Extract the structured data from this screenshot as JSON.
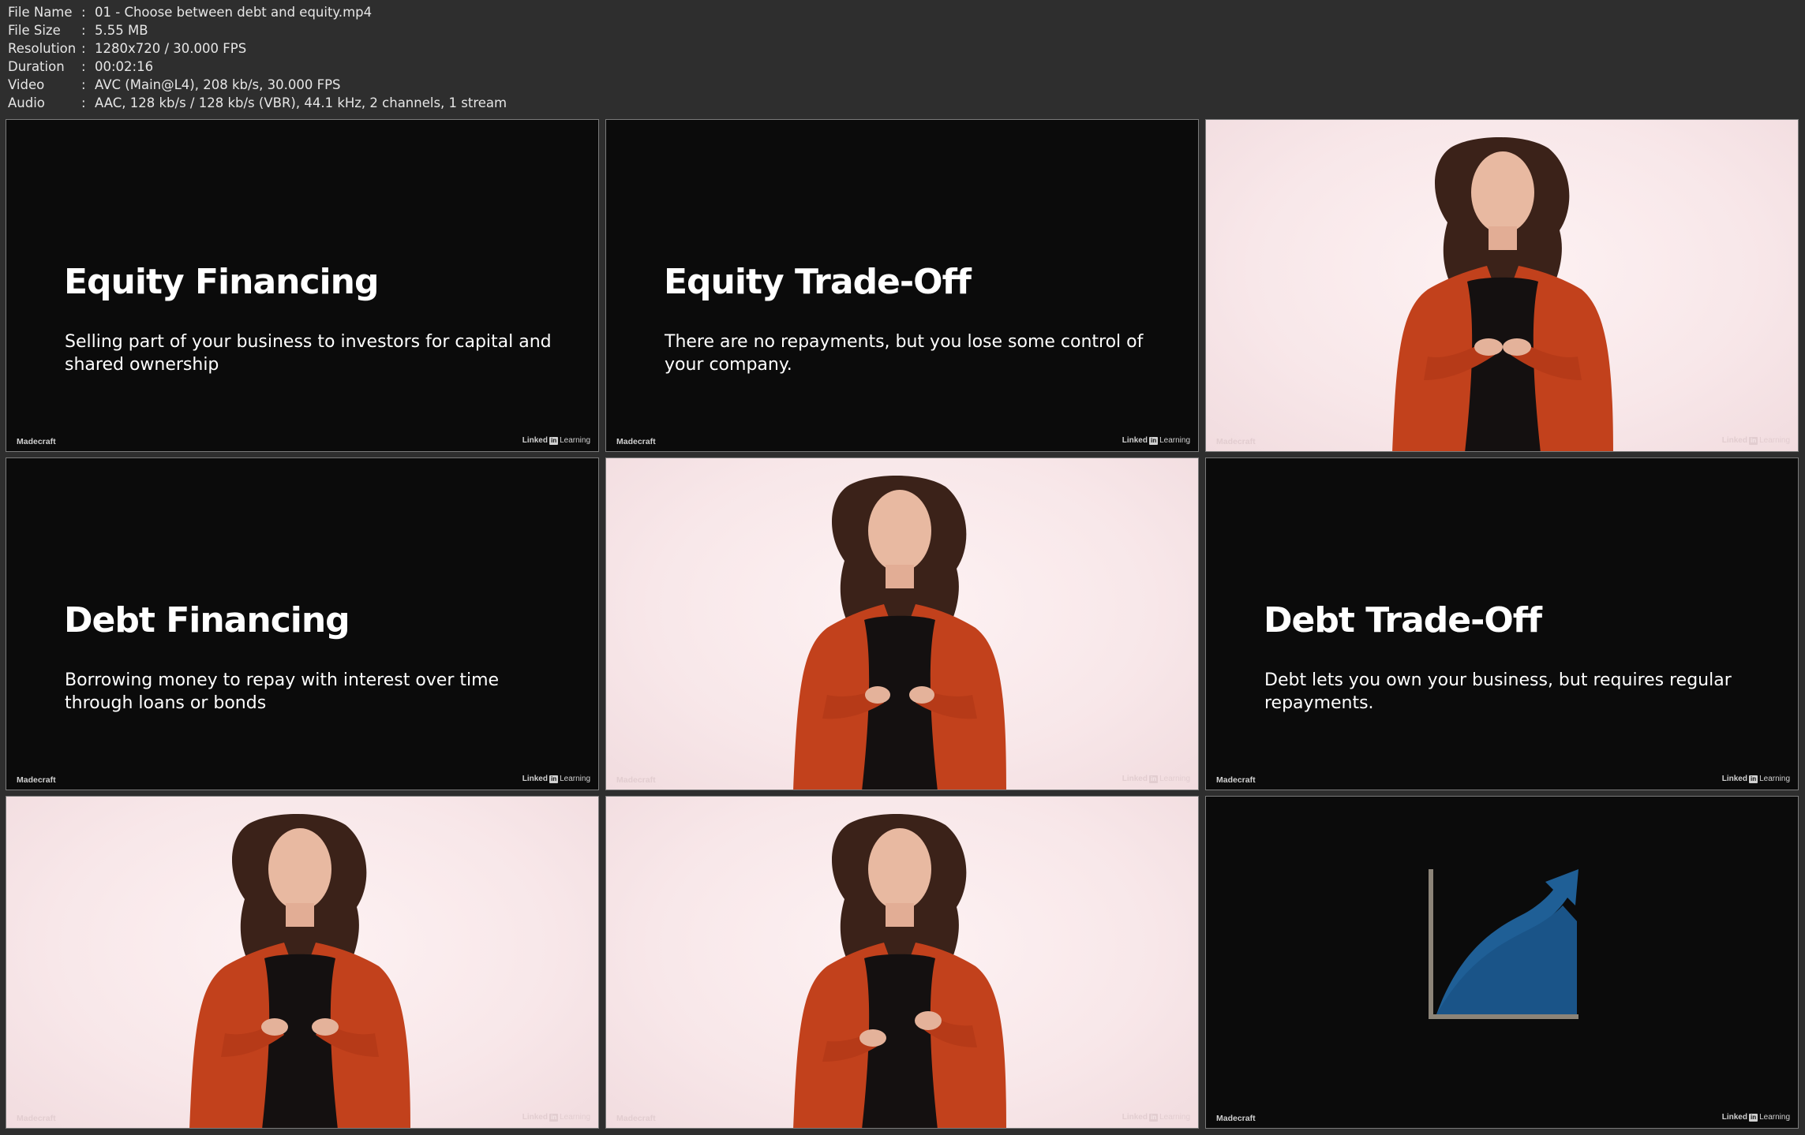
{
  "info": {
    "rows": [
      {
        "key": "File Name",
        "sep": ":",
        "value": "01 - Choose between debt and equity.mp4"
      },
      {
        "key": "File Size",
        "sep": ":",
        "value": "5.55 MB"
      },
      {
        "key": "Resolution",
        "sep": ":",
        "value": "1280x720 / 30.000 FPS"
      },
      {
        "key": "Duration",
        "sep": ":",
        "value": "00:02:16"
      },
      {
        "key": "Video",
        "sep": ":",
        "value": "AVC (Main@L4), 208 kb/s, 30.000 FPS"
      },
      {
        "key": "Audio",
        "sep": ":",
        "value": "AAC, 128 kb/s / 128 kb/s (VBR), 44.1 kHz, 2 channels, 1 stream"
      }
    ]
  },
  "watermark": {
    "left": "Madecraft",
    "brand": "Linked",
    "in": "in",
    "suffix": "Learning"
  },
  "thumbnails": [
    {
      "kind": "slide",
      "title": "Equity Financing",
      "body": "Selling part of your business to investors for capital and shared ownership"
    },
    {
      "kind": "slide",
      "title": "Equity Trade-Off",
      "body": "There are no repayments, but you lose some control of your company."
    },
    {
      "kind": "presenter",
      "pose": "hands-apart"
    },
    {
      "kind": "slide",
      "title": "Debt Financing",
      "body": "Borrowing money to repay with interest over time through loans or bonds"
    },
    {
      "kind": "presenter",
      "pose": "hands-together"
    },
    {
      "kind": "slide",
      "title": "Debt Trade-Off",
      "body": "Debt lets you own your business, but requires regular repayments."
    },
    {
      "kind": "presenter",
      "pose": "hands-apart"
    },
    {
      "kind": "presenter",
      "pose": "hands-gesture"
    },
    {
      "kind": "graphic",
      "icon": "growth-chart-icon"
    }
  ],
  "colors": {
    "background": "#2e2e2e",
    "slide_bg": "#0b0b0b",
    "studio_bg": "#f8e7e9",
    "blazer": "#c2411c",
    "chart_blue": "#1f5f96"
  }
}
